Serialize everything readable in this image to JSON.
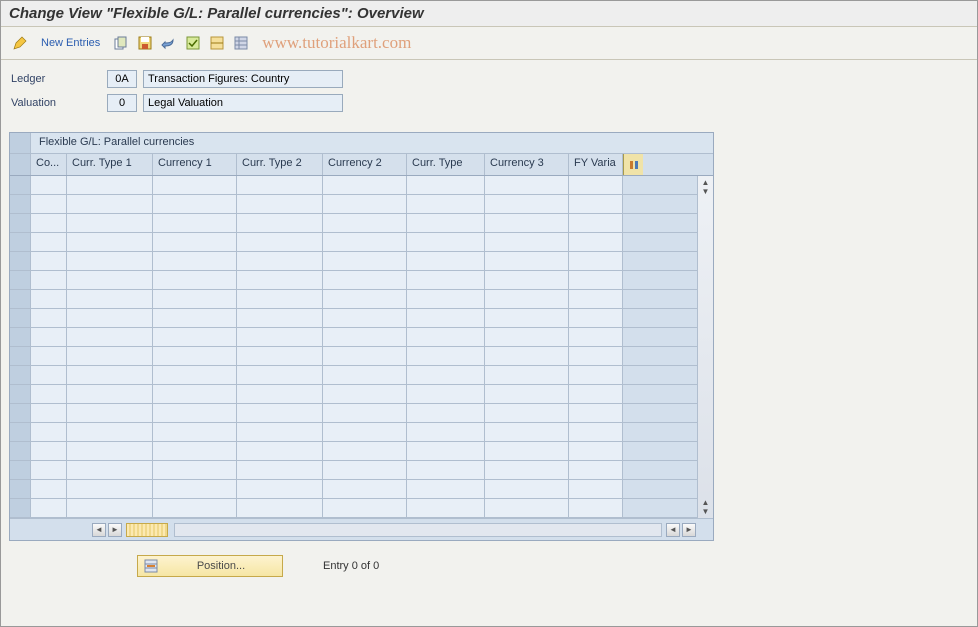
{
  "title": "Change View \"Flexible G/L: Parallel currencies\": Overview",
  "toolbar": {
    "new_entries_label": "New Entries",
    "watermark": "www.tutorialkart.com"
  },
  "form": {
    "ledger_label": "Ledger",
    "ledger_code": "0A",
    "ledger_desc": "Transaction Figures: Country",
    "valuation_label": "Valuation",
    "valuation_code": "0",
    "valuation_desc": "Legal Valuation"
  },
  "panel": {
    "title": "Flexible G/L: Parallel currencies",
    "columns": [
      "Co...",
      "Curr. Type 1",
      "Currency 1",
      "Curr. Type 2",
      "Currency 2",
      "Curr. Type",
      "Currency 3",
      "FY Varia"
    ]
  },
  "footer": {
    "position_label": "Position...",
    "entry_status": "Entry 0 of 0"
  }
}
